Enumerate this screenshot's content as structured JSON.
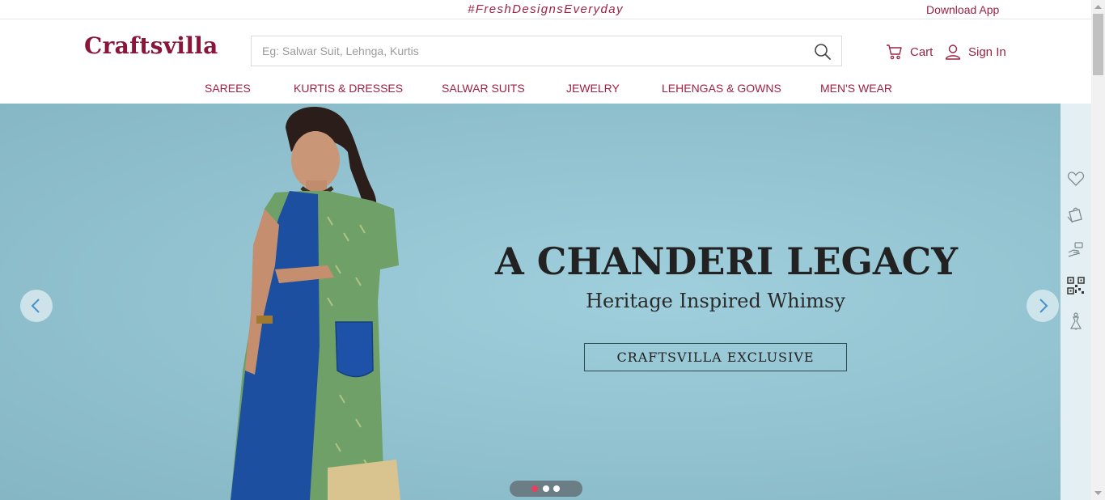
{
  "topbar": {
    "tagline": "#FreshDesignsEveryday",
    "download_app": "Download App"
  },
  "header": {
    "logo": "Craftsvilla",
    "search_placeholder": "Eg: Salwar Suit, Lehnga, Kurtis",
    "cart_label": "Cart",
    "signin_label": "Sign In"
  },
  "nav": {
    "items": [
      "SAREES",
      "KURTIS & DRESSES",
      "SALWAR SUITS",
      "JEWELRY",
      "LEHENGAS & GOWNS",
      "MEN'S WEAR"
    ]
  },
  "hero": {
    "title": "A CHANDERI LEGACY",
    "subtitle": "Heritage Inspired Whimsy",
    "badge": "CRAFTSVILLA EXCLUSIVE",
    "slides_total": 3,
    "active_slide": 1
  },
  "rail": {
    "icons": [
      "heart-icon",
      "gift-bag-icon",
      "hand-coin-icon",
      "qr-code-icon",
      "dress-form-icon"
    ]
  },
  "colors": {
    "brand": "#9b2242",
    "hero_bg": "#94c4d1",
    "rail_bg": "#e3eff2",
    "dot_active": "#e8415f"
  }
}
